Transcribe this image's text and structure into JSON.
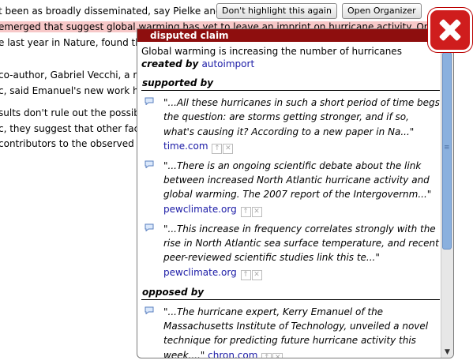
{
  "article": {
    "lines": [
      {
        "pre": "t been as broadly disseminated, say Pielke and",
        "hl": "",
        "post": ""
      },
      {
        "pre": "",
        "hl": "emerged that suggest global warming has yet to leave an imprint on hurricane activity. One of",
        "post": ""
      },
      {
        "pre": "e last year in Nature, found th",
        "hl": "",
        "post": ""
      },
      {
        "pre": "",
        "hl": "",
        "post": ""
      },
      {
        "pre": "co-author, Gabriel Vecchi, a re",
        "hl": "",
        "post": ""
      },
      {
        "pre": "c, said Emanuel's new work h",
        "hl": "",
        "post": ""
      },
      {
        "pre": "",
        "hl": "",
        "post": ""
      },
      {
        "pre": "sults don't rule out the possibi",
        "hl": "",
        "post": ""
      },
      {
        "pre": "c, they suggest that other fact",
        "hl": "",
        "post": ""
      },
      {
        "pre": "contributors to the observed inc",
        "hl": "",
        "post": ""
      }
    ]
  },
  "toolbar": {
    "dont_highlight_label": "Don't highlight this again",
    "open_organizer_label": "Open Organizer"
  },
  "popup": {
    "title": "disputed claim",
    "claim": "Global warming is increasing the number of hurricanes",
    "created_by_label": "created by",
    "author": "autoimport",
    "supported_heading": "supported by",
    "opposed_heading": "opposed by",
    "supported": [
      {
        "quote": "\"...All these hurricanes in such a short period of time begs the question: are storms getting stronger, and if so, what's causing it? According to a new paper in Na...\"",
        "source": "time.com"
      },
      {
        "quote": "\"...There is an ongoing scientific debate about the link between increased North Atlantic hurricane activity and global warming. The 2007 report of the Intergovernm...\"",
        "source": "pewclimate.org"
      },
      {
        "quote": "\"...This increase in frequency correlates strongly with the rise in North Atlantic sea surface temperature, and recent peer-reviewed scientific studies link this te...\"",
        "source": "pewclimate.org"
      }
    ],
    "opposed": [
      {
        "quote": "\"...The hurricane expert, Kerry Emanuel of the Massachusetts Institute of Technology, unveiled a novel technique for predicting future hurricane activity this week....\"",
        "source": "chron.com"
      }
    ]
  },
  "icons": {
    "close": "close-icon",
    "speech_bubble": "speech-bubble-icon",
    "up_arrow": "arrow-up-icon",
    "remove": "x-icon"
  },
  "colors": {
    "title_bar": "#8e0e0e",
    "highlight": "#f7c8c8",
    "link": "#1a1aa6",
    "close_button": "#cf1d1d"
  }
}
